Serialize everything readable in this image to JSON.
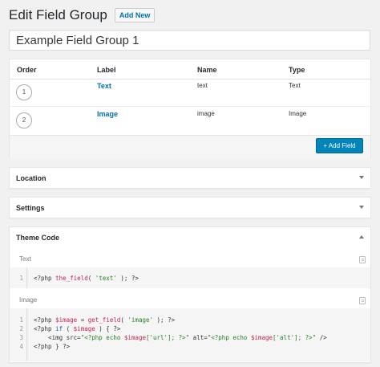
{
  "header": {
    "title": "Edit Field Group",
    "add_new": "Add New"
  },
  "title_input": {
    "value": "Example Field Group 1"
  },
  "fields": {
    "columns": [
      "Order",
      "Label",
      "Name",
      "Type"
    ],
    "rows": [
      {
        "order": "1",
        "label": "Text",
        "name": "text",
        "type": "Text"
      },
      {
        "order": "2",
        "label": "Image",
        "name": "image",
        "type": "Image"
      }
    ],
    "add_field": "+ Add Field"
  },
  "panels": {
    "location": "Location",
    "settings": "Settings",
    "theme_code": "Theme Code"
  },
  "theme_code": {
    "text_label": "Text",
    "text_lines": [
      {
        "n": "1",
        "parts": [
          {
            "t": "<?php ",
            "c": ""
          },
          {
            "t": "the_field",
            "c": "t-red"
          },
          {
            "t": "( ",
            "c": ""
          },
          {
            "t": "'text'",
            "c": "t-green"
          },
          {
            "t": " ); ?>",
            "c": ""
          }
        ]
      }
    ],
    "image_label": "Image",
    "image_lines": [
      {
        "n": "1",
        "parts": [
          {
            "t": "<?php ",
            "c": ""
          },
          {
            "t": "$image",
            "c": "t-red"
          },
          {
            "t": " = ",
            "c": ""
          },
          {
            "t": "get_field",
            "c": "t-red"
          },
          {
            "t": "( ",
            "c": ""
          },
          {
            "t": "'image'",
            "c": "t-green"
          },
          {
            "t": " ); ?>",
            "c": ""
          }
        ]
      },
      {
        "n": "2",
        "parts": [
          {
            "t": "<?php ",
            "c": ""
          },
          {
            "t": "if",
            "c": "t-blue"
          },
          {
            "t": " ( ",
            "c": ""
          },
          {
            "t": "$image",
            "c": "t-red"
          },
          {
            "t": " ) { ?>",
            "c": ""
          }
        ]
      },
      {
        "n": "3",
        "parts": [
          {
            "t": "    <img src=",
            "c": ""
          },
          {
            "t": "\"<?php echo ",
            "c": "t-green"
          },
          {
            "t": "$image",
            "c": "t-red"
          },
          {
            "t": "['url']; ?>\"",
            "c": "t-green"
          },
          {
            "t": " alt=",
            "c": ""
          },
          {
            "t": "\"<?php echo ",
            "c": "t-green"
          },
          {
            "t": "$image",
            "c": "t-red"
          },
          {
            "t": "['alt']; ?>\"",
            "c": "t-green"
          },
          {
            "t": " />",
            "c": ""
          }
        ]
      },
      {
        "n": "4",
        "parts": [
          {
            "t": "<?php } ?>",
            "c": ""
          }
        ]
      }
    ]
  }
}
